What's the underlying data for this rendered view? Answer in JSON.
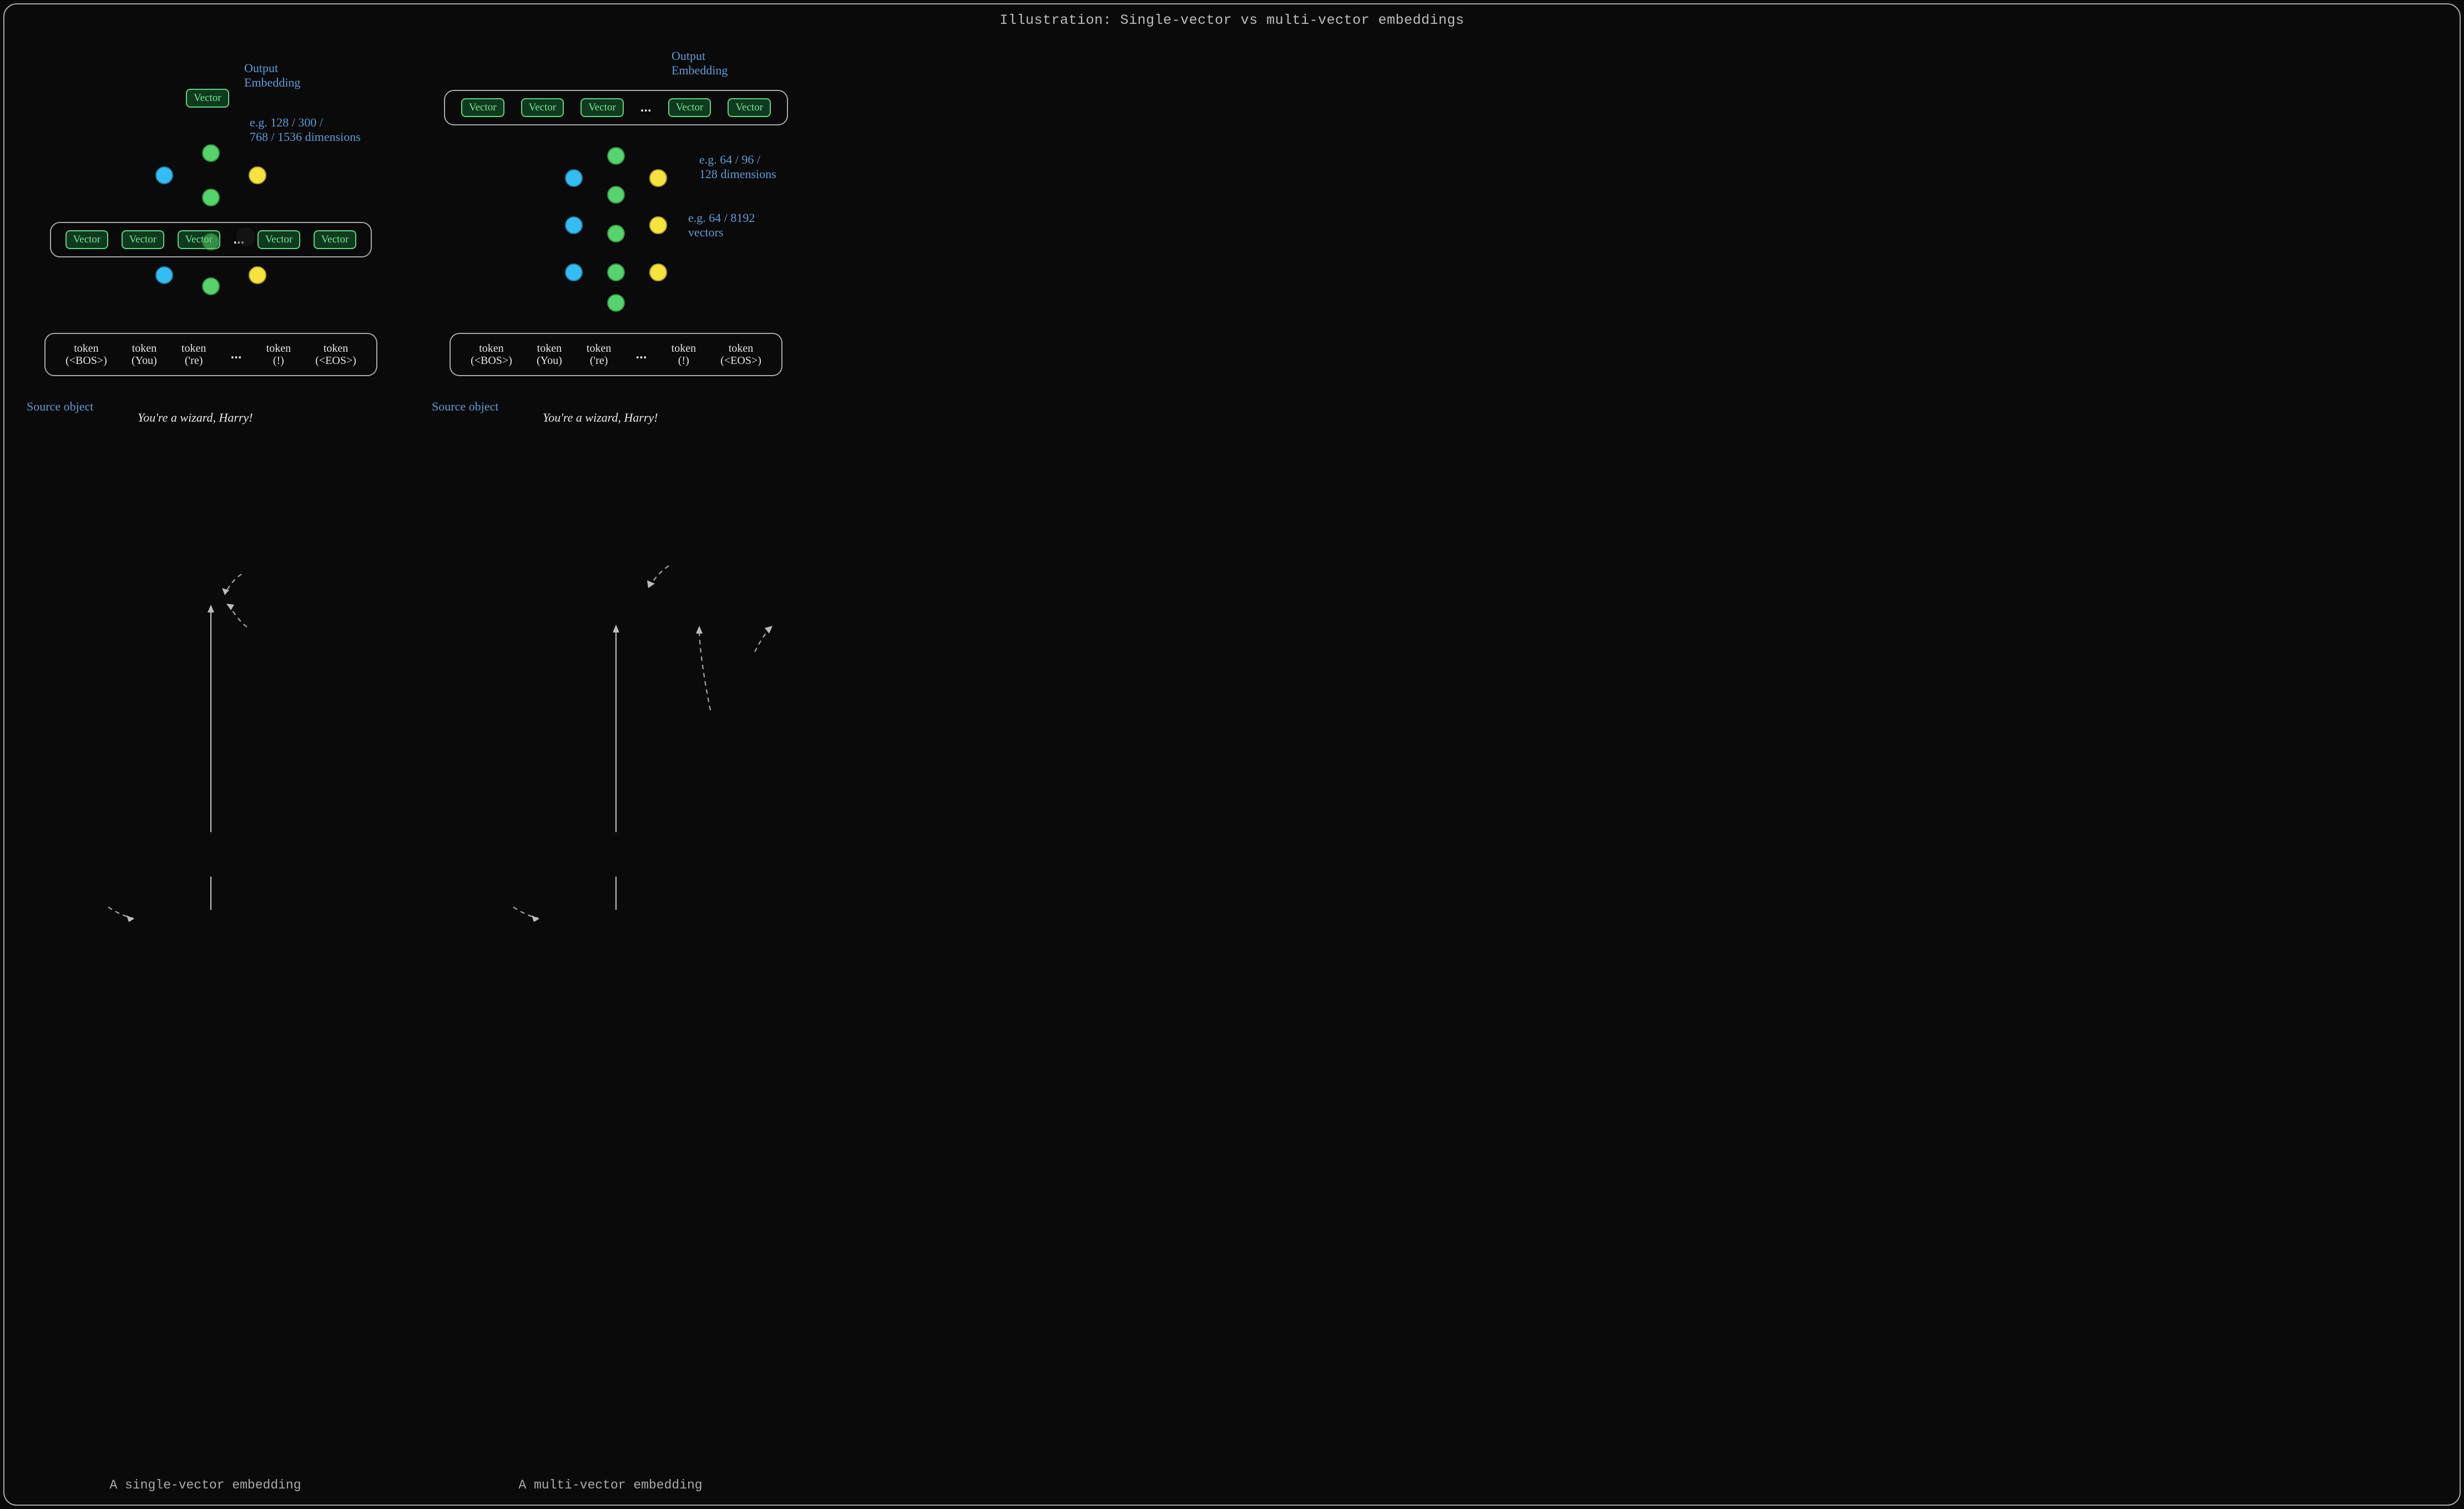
{
  "title": "Illustration: Single-vector vs multi-vector embeddings",
  "captions": {
    "left": "A single-vector embedding",
    "right": "A multi-vector embedding"
  },
  "vector_label": "Vector",
  "ellipsis": "...",
  "tokens": [
    {
      "t1": "token",
      "t2": "(<BOS>)"
    },
    {
      "t1": "token",
      "t2": "(You)"
    },
    {
      "t1": "token",
      "t2": "('re)"
    },
    {
      "t1": "token",
      "t2": "(!)"
    },
    {
      "t1": "token",
      "t2": "(<EOS>)"
    }
  ],
  "annotations": {
    "output_embedding": "Output\nEmbedding",
    "source_object": "Source object",
    "single_dims": "e.g. 128 / 300 /\n768 / 1536 dimensions",
    "multi_dims": "e.g. 64 / 96 /\n128 dimensions",
    "multi_vectors": "e.g. 64 / 8192\nvectors"
  },
  "source_text": "You're a wizard, Harry!"
}
